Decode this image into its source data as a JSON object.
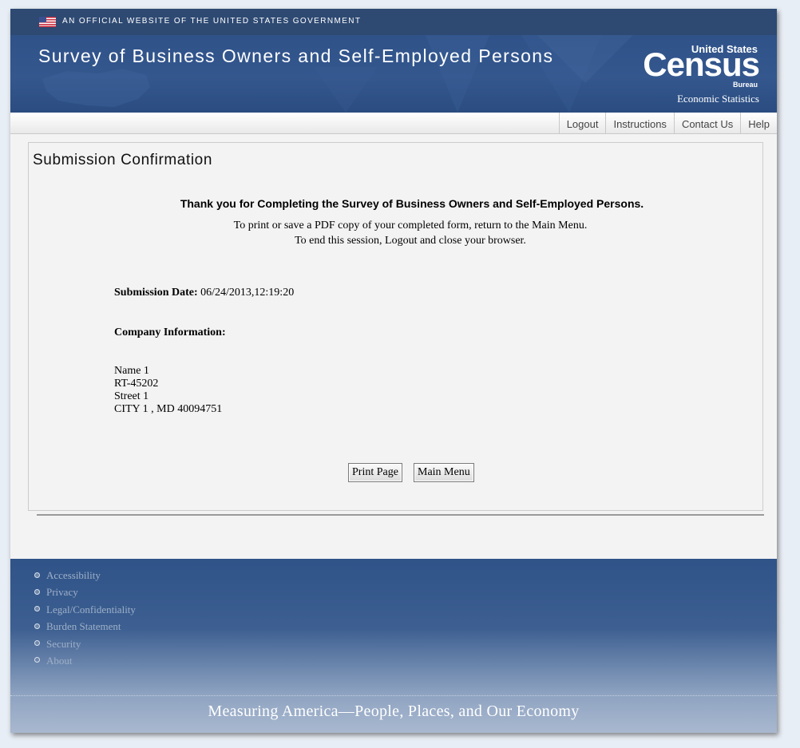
{
  "header": {
    "gov_notice": "AN OFFICIAL WEBSITE OF THE UNITED STATES GOVERNMENT",
    "site_title": "Survey of Business Owners and Self-Employed Persons",
    "logo": {
      "united_states": "United States",
      "census": "Census",
      "bureau": "Bureau",
      "economic_statistics": "Economic Statistics"
    }
  },
  "nav": {
    "items": [
      {
        "label": "Logout"
      },
      {
        "label": "Instructions"
      },
      {
        "label": "Contact Us"
      },
      {
        "label": "Help"
      }
    ]
  },
  "main": {
    "heading": "Submission Confirmation",
    "thanks": "Thank you for Completing the Survey of Business Owners and Self-Employed Persons.",
    "instructions": [
      "To print or save a PDF copy of your completed form, return to the Main Menu.",
      "To end this session, Logout and close your browser."
    ],
    "submission_date_label": "Submission Date:",
    "submission_date_value": "06/24/2013,12:19:20",
    "company_info_label": "Company Information:",
    "address": [
      "Name 1",
      "RT-45202",
      "Street 1",
      "CITY 1 , MD  40094751"
    ],
    "buttons": {
      "print": "Print Page",
      "main_menu": "Main Menu"
    }
  },
  "footer": {
    "links": [
      {
        "label": "Accessibility"
      },
      {
        "label": "Privacy"
      },
      {
        "label": "Legal/Confidentiality"
      },
      {
        "label": "Burden Statement"
      },
      {
        "label": "Security"
      },
      {
        "label": "About"
      }
    ],
    "tagline": "Measuring America—People, Places, and Our Economy"
  },
  "colors": {
    "gov_bar": "#2e4a73",
    "banner": "#2f5289",
    "footer_top": "#2f5388",
    "footer_bottom": "#a9b8cf"
  }
}
